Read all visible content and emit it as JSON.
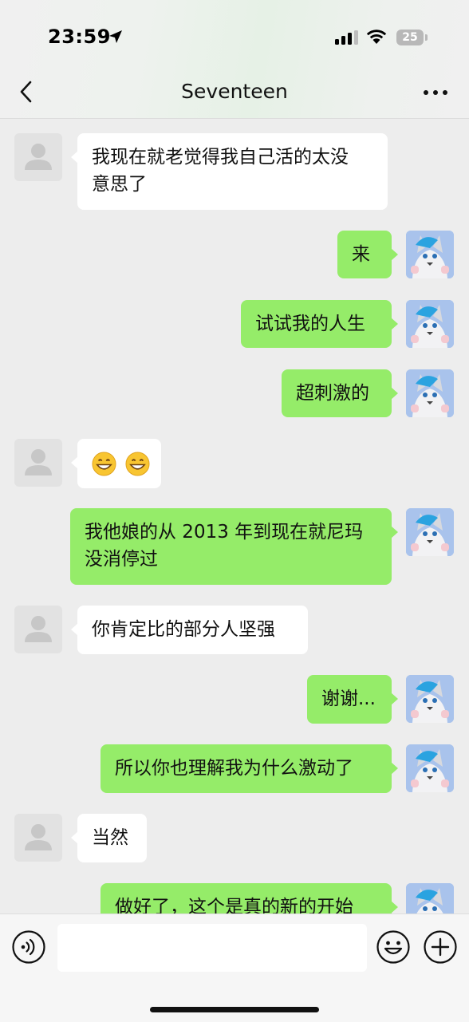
{
  "status_bar": {
    "time": "23:59",
    "battery": "25"
  },
  "header": {
    "title": "Seventeen"
  },
  "messages": [
    {
      "side": "in",
      "lines": [
        "我现在就老觉得我自己活的太没",
        "意思了"
      ]
    },
    {
      "side": "out",
      "text": "来"
    },
    {
      "side": "out",
      "text": "试试我的人生"
    },
    {
      "side": "out",
      "text": "超刺激的"
    },
    {
      "side": "in",
      "emoji_count": 2,
      "emoji": "grinning-face"
    },
    {
      "side": "out",
      "lines": [
        "我他娘的从 2013 年到现在就尼玛",
        "没消停过"
      ]
    },
    {
      "side": "in",
      "text": "你肯定比的部分人坚强"
    },
    {
      "side": "out",
      "text": "谢谢..."
    },
    {
      "side": "out",
      "text": "所以你也理解我为什么激动了"
    },
    {
      "side": "in",
      "text": "当然"
    },
    {
      "side": "out",
      "text": "做好了，这个是真的新的开始"
    }
  ],
  "input": {
    "value": ""
  },
  "colors": {
    "outgoing_bubble": "#95ec69",
    "incoming_bubble": "#ffffff",
    "background": "#ededed"
  }
}
